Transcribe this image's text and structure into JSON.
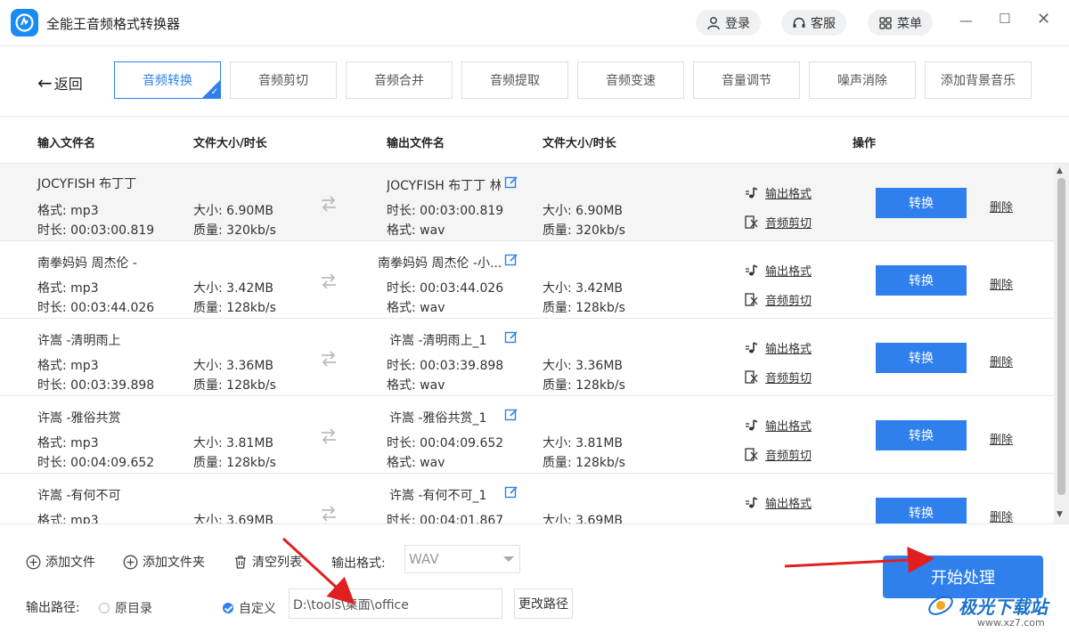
{
  "app": {
    "title": "全能王音频格式转换器",
    "login": "登录",
    "service": "客服",
    "menu": "菜单"
  },
  "nav": {
    "back": "返回",
    "tabs": [
      "音频转换",
      "音频剪切",
      "音频合并",
      "音频提取",
      "音频变速",
      "音量调节",
      "噪声消除",
      "添加背景音乐"
    ],
    "active_tab": "音频转换"
  },
  "table": {
    "headers": {
      "input_name": "输入文件名",
      "input_size": "文件大小/时长",
      "output_name": "输出文件名",
      "output_size": "文件大小/时长",
      "actions": "操作"
    },
    "rows": [
      {
        "in_name": "JOCYFISH 布丁丁",
        "in_format": "格式: mp3",
        "in_duration": "时长: 00:03:00.819",
        "in_size": "大小: 6.90MB",
        "in_quality": "质量: 320kb/s",
        "out_name": "JOCYFISH 布丁丁 林...",
        "out_duration": "时长: 00:03:00.819",
        "out_format": "格式: wav",
        "out_size": "大小: 6.90MB",
        "out_quality": "质量: 320kb/s"
      },
      {
        "in_name": "南拳妈妈 周杰伦 -",
        "in_format": "格式: mp3",
        "in_duration": "时长: 00:03:44.026",
        "in_size": "大小: 3.42MB",
        "in_quality": "质量: 128kb/s",
        "out_name": "南拳妈妈 周杰伦 -小...",
        "out_duration": "时长: 00:03:44.026",
        "out_format": "格式: wav",
        "out_size": "大小: 3.42MB",
        "out_quality": "质量: 128kb/s"
      },
      {
        "in_name": "许嵩 -清明雨上",
        "in_format": "格式: mp3",
        "in_duration": "时长: 00:03:39.898",
        "in_size": "大小: 3.36MB",
        "in_quality": "质量: 128kb/s",
        "out_name": "许嵩 -清明雨上_1",
        "out_duration": "时长: 00:03:39.898",
        "out_format": "格式: wav",
        "out_size": "大小: 3.36MB",
        "out_quality": "质量: 128kb/s"
      },
      {
        "in_name": "许嵩 -雅俗共赏",
        "in_format": "格式: mp3",
        "in_duration": "时长: 00:04:09.652",
        "in_size": "大小: 3.81MB",
        "in_quality": "质量: 128kb/s",
        "out_name": "许嵩 -雅俗共赏_1",
        "out_duration": "时长: 00:04:09.652",
        "out_format": "格式: wav",
        "out_size": "大小: 3.81MB",
        "out_quality": "质量: 128kb/s"
      },
      {
        "in_name": "许嵩 -有何不可",
        "in_format": "格式: mp3",
        "in_duration": "",
        "in_size": "大小: 3.69MB",
        "in_quality": "",
        "out_name": "许嵩 -有何不可_1",
        "out_duration": "时长: 00:04:01.867",
        "out_format": "",
        "out_size": "大小: 3.69MB",
        "out_quality": ""
      }
    ],
    "action_format": "输出格式",
    "action_cut": "音频剪切",
    "action_convert": "转换",
    "action_delete": "删除"
  },
  "bottom": {
    "add_file": "添加文件",
    "add_folder": "添加文件夹",
    "clear_list": "清空列表",
    "output_format_label": "输出格式:",
    "output_format_value": "WAV",
    "output_path_label": "输出路径:",
    "original_dir": "原目录",
    "custom": "自定义",
    "path_value": "D:\\tools\\桌面\\office",
    "change_path": "更改路径",
    "start": "开始处理"
  },
  "watermark": {
    "text": "极光下载站",
    "url": "www.xz7.com"
  },
  "colors": {
    "accent": "#2f80ed",
    "annotation_arrow": "#e02020"
  }
}
